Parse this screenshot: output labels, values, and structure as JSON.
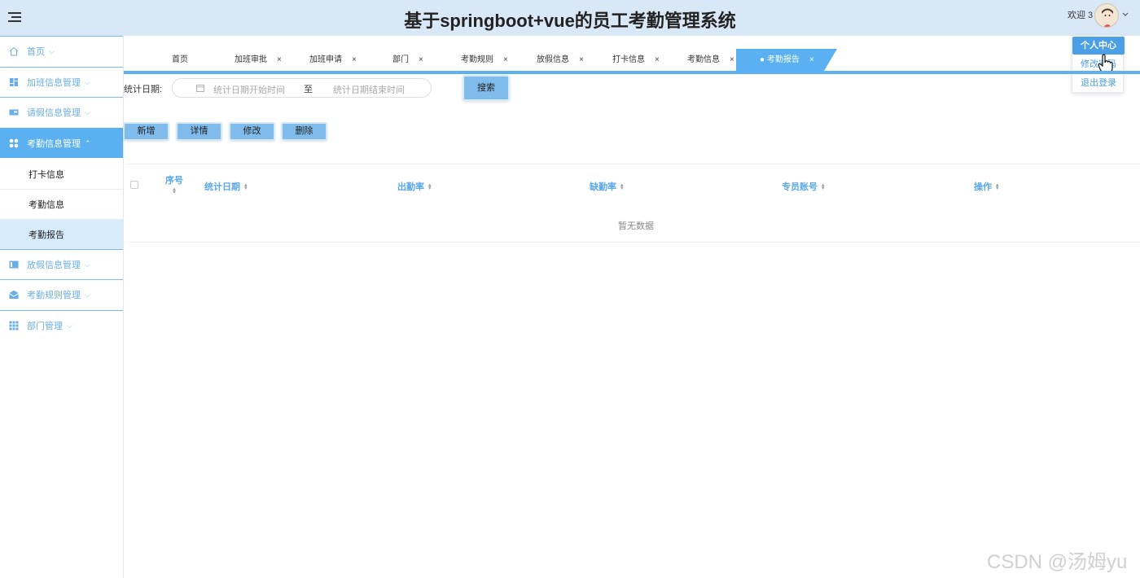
{
  "header": {
    "title": "基于springboot+vue的员工考勤管理系统",
    "welcome": "欢迎 3"
  },
  "user_menu": {
    "items": [
      "个人中心",
      "修改密码",
      "退出登录"
    ]
  },
  "sidebar": {
    "home": "首页",
    "groups": [
      {
        "label": "加班信息管理",
        "icon": "dashboard-icon"
      },
      {
        "label": "请假信息管理",
        "icon": "card-icon"
      },
      {
        "label": "考勤信息管理",
        "icon": "grid-icon"
      },
      {
        "label": "放假信息管理",
        "icon": "calendar-icon"
      },
      {
        "label": "考勤规则管理",
        "icon": "mail-icon"
      },
      {
        "label": "部门管理",
        "icon": "apps-icon"
      }
    ],
    "sub_items": [
      "打卡信息",
      "考勤信息",
      "考勤报告"
    ]
  },
  "tabs": [
    {
      "label": "首页"
    },
    {
      "label": "加班审批"
    },
    {
      "label": "加班申请"
    },
    {
      "label": "部门"
    },
    {
      "label": "考勤规则"
    },
    {
      "label": "放假信息"
    },
    {
      "label": "打卡信息"
    },
    {
      "label": "考勤信息"
    },
    {
      "label": "● 考勤报告"
    }
  ],
  "search": {
    "label": "统计日期:",
    "start_placeholder": "统计日期开始时间",
    "separator": "至",
    "end_placeholder": "统计日期结束时间",
    "button": "搜索"
  },
  "actions": {
    "add": "新增",
    "detail": "详情",
    "edit": "修改",
    "delete": "删除"
  },
  "table": {
    "columns": [
      "序号",
      "统计日期",
      "出勤率",
      "缺勤率",
      "专员账号",
      "操作"
    ],
    "empty": "暂无数据"
  },
  "watermark": "CSDN @汤姆yu",
  "colors": {
    "accent": "#5ab0f0",
    "header_bg": "#d9e8f7",
    "button_bg": "#7fbcec"
  }
}
